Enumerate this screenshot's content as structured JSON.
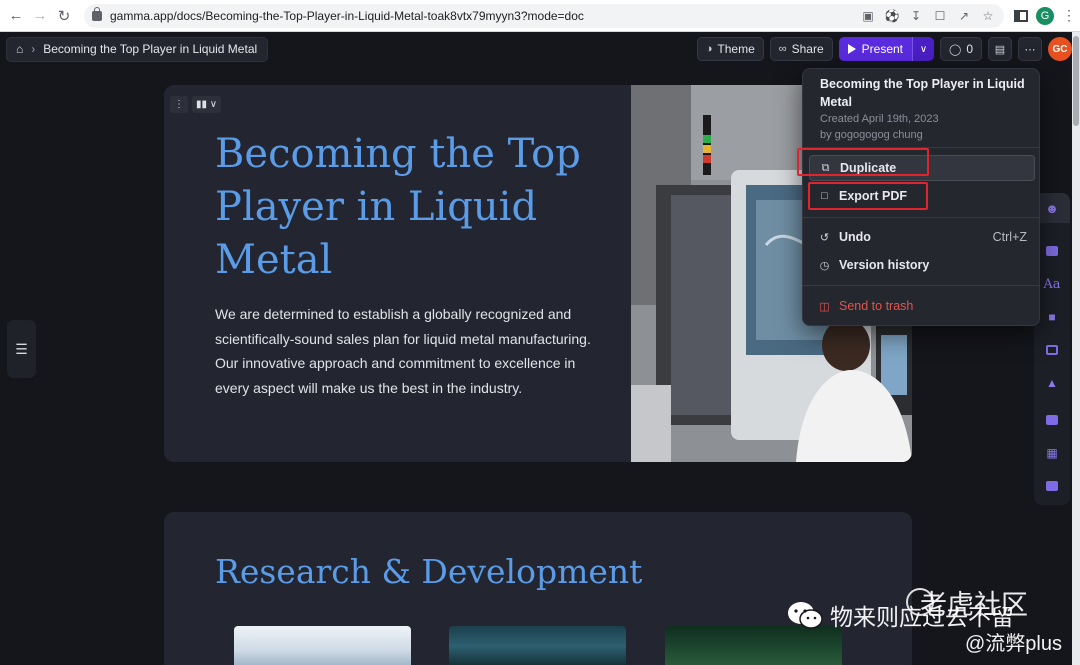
{
  "browser": {
    "url": "gamma.app/docs/Becoming-the-Top-Player-in-Liquid-Metal-toak8vtx79myyn3?mode=doc",
    "profile_initial": "G"
  },
  "breadcrumb": {
    "title": "Becoming the Top Player in Liquid Metal"
  },
  "toolbar": {
    "theme_label": "Theme",
    "share_label": "Share",
    "present_label": "Present",
    "comment_count": "0",
    "avatar_initials": "GC"
  },
  "card1": {
    "heading": "Becoming the Top Player in Liquid Metal",
    "body": "We are determined to establish a globally recognized and scientifically-sound sales plan for liquid metal manufacturing. Our innovative approach and commitment to excellence in every aspect will make us the best in the industry."
  },
  "card2": {
    "heading": "Research & Development"
  },
  "menu": {
    "title": "Becoming the Top Player in Liquid Metal",
    "created": "Created April 19th, 2023",
    "author": "by gogogogog chung",
    "items": [
      {
        "label": "Duplicate",
        "icon": "copy-icon"
      },
      {
        "label": "Export PDF",
        "icon": "file-icon"
      },
      {
        "label": "Undo",
        "icon": "undo-icon",
        "shortcut": "Ctrl+Z"
      },
      {
        "label": "Version history",
        "icon": "clock-icon"
      },
      {
        "label": "Send to trash",
        "icon": "trash-icon"
      }
    ]
  },
  "right_sidebar": {
    "font_label": "Aa"
  },
  "watermark": {
    "line1": "老虎社区",
    "line2": "物来则应过去不留",
    "line3": "@流弊plus"
  },
  "colors": {
    "accent": "#5b2be0",
    "heading": "#5a9ce8",
    "danger": "#e5534b",
    "highlight": "#e0262c",
    "avatar": "#e8501f"
  }
}
